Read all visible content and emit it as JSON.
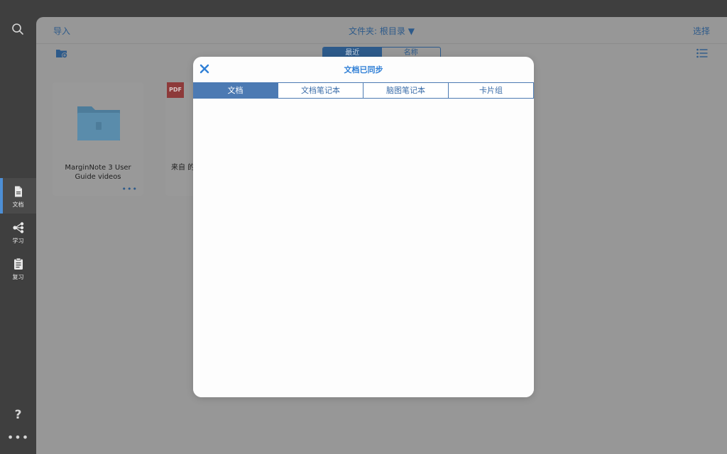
{
  "rail": {
    "items": [
      {
        "label": "文档",
        "icon": "document-icon",
        "active": true
      },
      {
        "label": "学习",
        "icon": "mindmap-icon",
        "active": false
      },
      {
        "label": "复习",
        "icon": "clipboard-icon",
        "active": false
      }
    ],
    "help": "?",
    "more": "•••"
  },
  "library": {
    "import_label": "导入",
    "folder_title": "文件夹: 根目录 ▼",
    "select_label": "选择",
    "sort_options": [
      "最近",
      "名称"
    ],
    "selected_sort": "最近",
    "items": [
      {
        "name": "MarginNote 3 User Guide videos",
        "type": "folder"
      },
      {
        "name": "来自 的文",
        "type": "pdf",
        "badge": "PDF"
      }
    ],
    "more_dots": "•••"
  },
  "modal": {
    "title": "文档已同步",
    "tabs": [
      "文档",
      "文档笔记本",
      "脑图笔记本",
      "卡片组"
    ],
    "active_tab": "文档"
  },
  "colors": {
    "accent": "#2f7fd6",
    "tab_active": "#4c7ab3",
    "rail_bg": "#3f3f3f",
    "overlay": "#979797"
  }
}
